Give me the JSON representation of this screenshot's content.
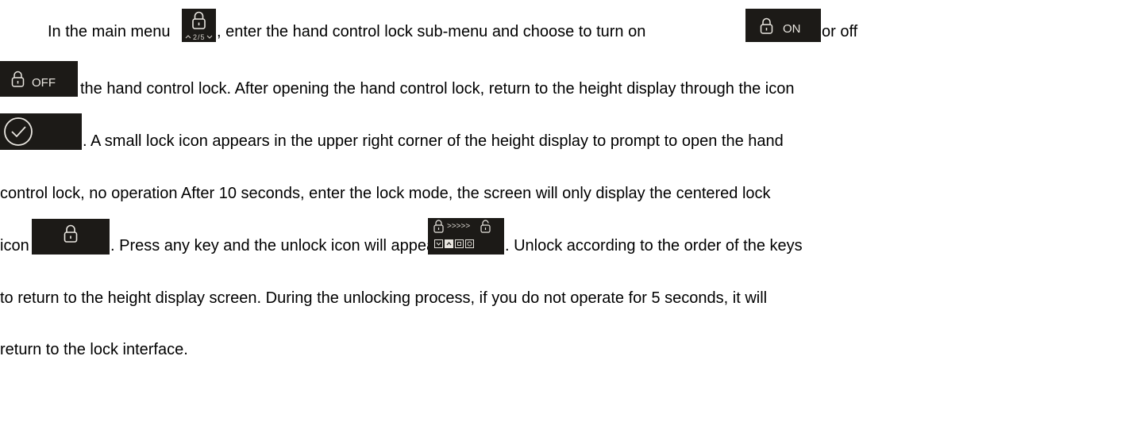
{
  "paragraph": {
    "l1a": "In the main menu",
    "l1b": ", enter the hand control lock sub-menu and choose to turn on",
    "l1c": "or off",
    "l2": "the hand control lock. After opening the hand control lock, return to the height display through the icon",
    "l3": ". A small lock icon appears in the upper right corner of the height display to prompt to open the hand",
    "l4": "control lock, no operation After 10 seconds, enter the lock mode, the screen will only display the centered lock",
    "l5a": "icon",
    "l5b": ". Press any key and the unlock icon will appear",
    "l5c": ". Unlock according to the order of the keys",
    "l6": "to return to the height display screen. During the unlocking process, if you do not operate for 5 seconds, it will",
    "l7": "return to the lock interface."
  },
  "icons": {
    "menu_page": "2/5",
    "on_label": "ON",
    "off_label": "OFF",
    "unlock_arrows": ">>>>>"
  },
  "colors": {
    "screen_bg": "#1c1a17",
    "screen_fg": "#e9e6e0"
  }
}
